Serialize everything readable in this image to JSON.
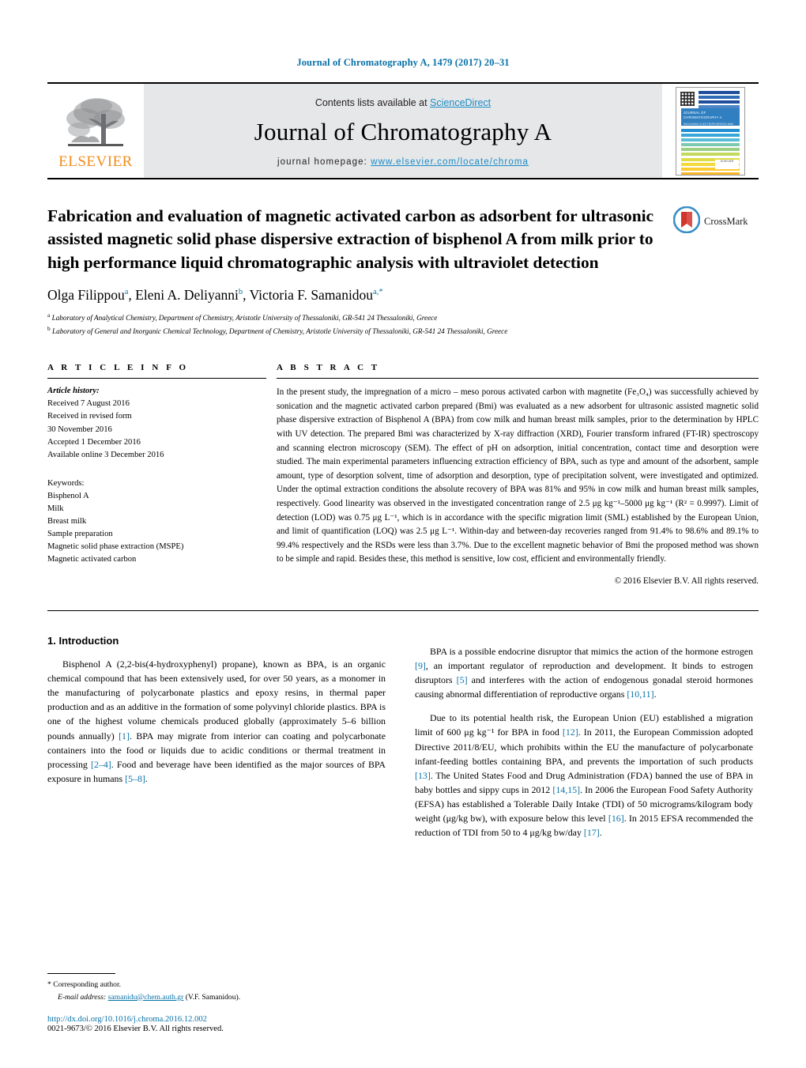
{
  "running_head": "Journal of Chromatography A, 1479 (2017) 20–31",
  "masthead": {
    "contents_prefix": "Contents lists available at ",
    "sciencedirect": "ScienceDirect",
    "journal_title": "Journal of Chromatography A",
    "homepage_prefix": "journal homepage: ",
    "homepage_url": "www.elsevier.com/locate/chroma",
    "publisher": "ELSEVIER",
    "cover_title": "JOURNAL OF CHROMATOGRAPHY A",
    "cover_subtitle": "INCLUDING ELECTROPHORESIS AND OTHER SEPARATION METHODS",
    "accent_blue": "#0a72a8",
    "accent_orange": "#f08c1c",
    "masthead_bg": "#e6e7e8"
  },
  "article": {
    "title": "Fabrication and evaluation of magnetic activated carbon as adsorbent for ultrasonic assisted magnetic solid phase dispersive extraction of bisphenol A from milk prior to high performance liquid chromatographic analysis with ultraviolet detection",
    "crossmark_label": "CrossMark",
    "authors_html": "Olga Filippou<sup>a</sup>, Eleni A. Deliyanni<sup>b</sup>, Victoria F. Samanidou<sup>a,*</sup>",
    "affiliations": [
      {
        "marker": "a",
        "text": "Laboratory of Analytical Chemistry, Department of Chemistry, Aristotle University of Thessaloniki, GR-541 24 Thessaloniki, Greece"
      },
      {
        "marker": "b",
        "text": "Laboratory of General and Inorganic Chemical Technology, Department of Chemistry, Aristotle University of Thessaloniki, GR-541 24 Thessaloniki, Greece"
      }
    ]
  },
  "article_info": {
    "heading": "A R T I C L E   I N F O",
    "history_label": "Article history:",
    "history": [
      "Received 7 August 2016",
      "Received in revised form",
      "30 November 2016",
      "Accepted 1 December 2016",
      "Available online 3 December 2016"
    ],
    "keywords_label": "Keywords:",
    "keywords": [
      "Bisphenol A",
      "Milk",
      "Breast milk",
      "Sample preparation",
      "Magnetic solid phase extraction (MSPE)",
      "Magnetic activated carbon"
    ]
  },
  "abstract": {
    "heading": "A B S T R A C T",
    "text": "In the present study, the impregnation of a micro – meso porous activated carbon with magnetite (Fe₃O₄) was successfully achieved by sonication and the magnetic activated carbon prepared (Bmi) was evaluated as a new adsorbent for ultrasonic assisted magnetic solid phase dispersive extraction of Bisphenol A (BPA) from cow milk and human breast milk samples, prior to the determination by HPLC with UV detection. The prepared Bmi was characterized by X-ray diffraction (XRD), Fourier transform infrared (FT-IR) spectroscopy and scanning electron microscopy (SEM). The effect of pH on adsorption, initial concentration, contact time and desorption were studied. The main experimental parameters influencing extraction efficiency of BPA, such as type and amount of the adsorbent, sample amount, type of desorption solvent, time of adsorption and desorption, type of precipitation solvent, were investigated and optimized. Under the optimal extraction conditions the absolute recovery of BPA was 81% and 95% in cow milk and human breast milk samples, respectively. Good linearity was observed in the investigated concentration range of 2.5 μg kg⁻¹–5000 μg kg⁻¹ (R² = 0.9997). Limit of detection (LOD) was 0.75 μg L⁻¹, which is in accordance with the specific migration limit (SML) established by the European Union, and limit of quantification (LOQ) was 2.5 μg L⁻¹. Within-day and between-day recoveries ranged from 91.4% to 98.6% and 89.1% to 99.4% respectively and the RSDs were less than 3.7%. Due to the excellent magnetic behavior of Bmi the proposed method was shown to be simple and rapid. Besides these, this method is sensitive, low cost, efficient and environmentally friendly.",
    "copyright": "© 2016 Elsevier B.V. All rights reserved."
  },
  "introduction": {
    "heading": "1.  Introduction",
    "left_paragraphs": [
      "Bisphenol A (2,2-bis(4-hydroxyphenyl) propane), known as BPA, is an organic chemical compound that has been extensively used, for over 50 years, as a monomer in the manufacturing of polycarbonate plastics and epoxy resins, in thermal paper production and as an additive in the formation of some polyvinyl chloride plastics. BPA is one of the highest volume chemicals produced globally (approximately 5–6 billion pounds annually) [1]. BPA may migrate from interior can coating and polycarbonate containers into the food or liquids due to acidic conditions or thermal treatment in processing [2–4]. Food and beverage have been identified as the major sources of BPA exposure in humans [5–8]."
    ],
    "right_paragraphs": [
      "BPA is a possible endocrine disruptor that mimics the action of the hormone estrogen [9], an important regulator of reproduction and development. It binds to estrogen disruptors [5] and interferes with the action of endogenous gonadal steroid hormones causing abnormal differentiation of reproductive organs [10,11].",
      "Due to its potential health risk, the European Union (EU) established a migration limit of 600 μg kg⁻¹ for BPA in food [12]. In 2011, the European Commission adopted Directive 2011/8/EU, which prohibits within the EU the manufacture of polycarbonate infant-feeding bottles containing BPA, and prevents the importation of such products [13]. The United States Food and Drug Administration (FDA) banned the use of BPA in baby bottles and sippy cups in 2012 [14,15]. In 2006 the European Food Safety Authority (EFSA) has established a Tolerable Daily Intake (TDI) of 50 micrograms/kilogram body weight (μg/kg bw), with exposure below this level [16]. In 2015 EFSA recommended the reduction of TDI from 50 to 4 μg/kg bw/day [17]."
    ]
  },
  "footer": {
    "corresponding_marker": "*",
    "corresponding_label": "Corresponding author.",
    "email_label": "E-mail address:",
    "email": "samanidu@chem.auth.gr",
    "email_owner": "(V.F. Samanidou).",
    "doi": "http://dx.doi.org/10.1016/j.chroma.2016.12.002",
    "issn_line": "0021-9673/© 2016 Elsevier B.V. All rights reserved."
  }
}
